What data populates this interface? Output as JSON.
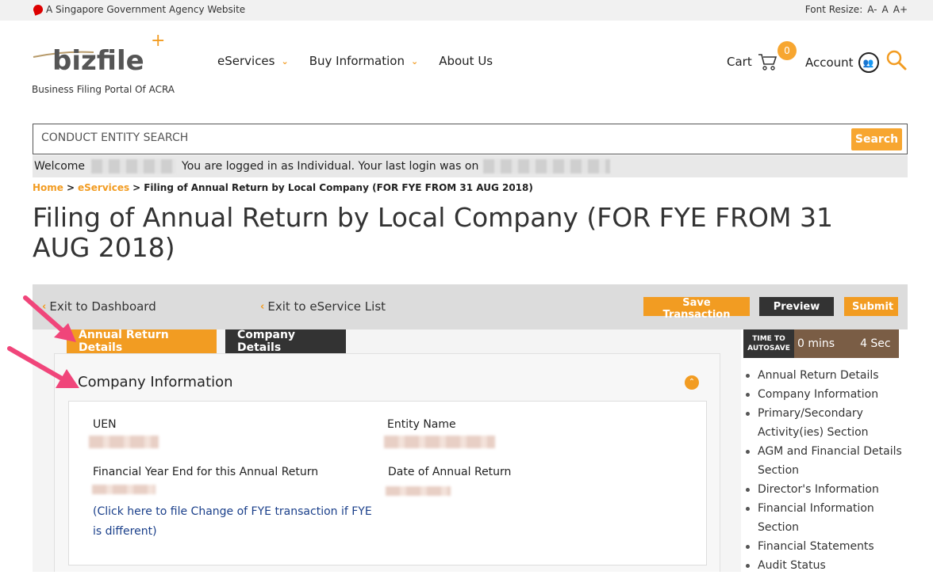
{
  "gov_bar": {
    "agency_text": "A Singapore Government Agency Website",
    "font_resize_label": "Font Resize:",
    "font_sizes": [
      "A-",
      "A",
      "A+"
    ]
  },
  "header": {
    "logo_text": "bizfile",
    "logo_plus": "+",
    "tagline": "Business Filing Portal Of ACRA",
    "nav": [
      {
        "label": "eServices",
        "has_dropdown": true
      },
      {
        "label": "Buy Information",
        "has_dropdown": true
      },
      {
        "label": "About Us",
        "has_dropdown": false
      }
    ],
    "cart_label": "Cart",
    "cart_count": "0",
    "account_label": "Account"
  },
  "search": {
    "placeholder": "CONDUCT ENTITY SEARCH",
    "button_label": "Search"
  },
  "welcome": {
    "welcome_label": "Welcome",
    "login_text": "You are logged in as Individual. Your last login was on"
  },
  "breadcrumb": {
    "home": "Home",
    "eservices": "eServices",
    "current": "Filing of Annual Return by Local Company (FOR FYE FROM 31 AUG 2018)",
    "separator": ">"
  },
  "page_title": "Filing of Annual Return by Local Company (FOR FYE FROM 31 AUG 2018)",
  "actions": {
    "exit_dashboard": "Exit to Dashboard",
    "exit_service_list": "Exit to eService List",
    "save": "Save Transaction",
    "preview": "Preview",
    "submit": "Submit"
  },
  "tabs": [
    {
      "label": "Annual Return Details",
      "active": true
    },
    {
      "label": "Company Details",
      "active": false
    }
  ],
  "section": {
    "title": "Company Information",
    "fields": {
      "uen": "UEN",
      "entity_name": "Entity Name",
      "fye": "Financial Year End for this Annual Return",
      "date_ar": "Date of Annual Return"
    },
    "fye_link": "(Click here to file Change of FYE transaction if FYE is different)"
  },
  "timer": {
    "label": "TIME TO AUTOSAVE",
    "mins": "0 mins",
    "secs": "4 Sec"
  },
  "side_nav": [
    "Annual Return Details",
    "Company Information",
    "Primary/Secondary Activity(ies) Section",
    "AGM and Financial Details Section",
    "Director's Information",
    "Financial Information Section",
    "Financial Statements",
    "Audit Status"
  ],
  "colors": {
    "accent": "#f29c22",
    "dark": "#333333",
    "link": "#1a3f8a",
    "annotation_arrow": "#f0457a"
  }
}
